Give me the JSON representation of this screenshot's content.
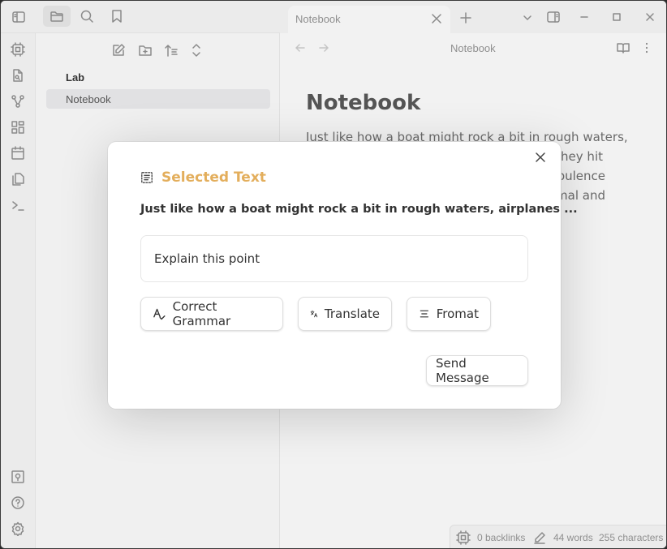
{
  "window": {
    "title_tab": "Notebook",
    "accent": "#e3ae5c"
  },
  "top_icons": [
    "sidebar-toggle-icon",
    "folder-icon",
    "search-icon",
    "bookmark-icon"
  ],
  "sidebar": {
    "toolbar": [
      "new-note-icon",
      "new-folder-icon",
      "sort-icon",
      "collapse-icon"
    ],
    "items": [
      {
        "label": "Lab",
        "type": "folder"
      },
      {
        "label": "Notebook",
        "type": "file",
        "selected": true
      }
    ]
  },
  "ribbon": {
    "top": [
      "plugin-icon",
      "search-file-icon",
      "graph-icon",
      "grid-icon",
      "calendar-icon",
      "copy-icon",
      "terminal-icon"
    ],
    "bottom": [
      "vault-icon",
      "help-icon",
      "settings-icon"
    ]
  },
  "header": {
    "title": "Notebook"
  },
  "note": {
    "title": "Notebook",
    "lines": [
      "Just like how a boat might rock a bit in rough waters,",
      "they hit",
      "rbulence",
      "mal and"
    ]
  },
  "status": {
    "backlinks": "0 backlinks",
    "words": "44 words",
    "characters": "255 characters"
  },
  "modal": {
    "heading": "Selected Text",
    "selected_text": "Just like how a boat might rock a bit in rough waters, airplanes ...",
    "prompt_value": "Explain this point",
    "actions": [
      {
        "label": "Correct Grammar",
        "icon": "spell-check-icon"
      },
      {
        "label": "Translate",
        "icon": "translate-icon"
      },
      {
        "label": "Fromat",
        "icon": "align-center-icon"
      }
    ],
    "send_label": "Send Message"
  }
}
